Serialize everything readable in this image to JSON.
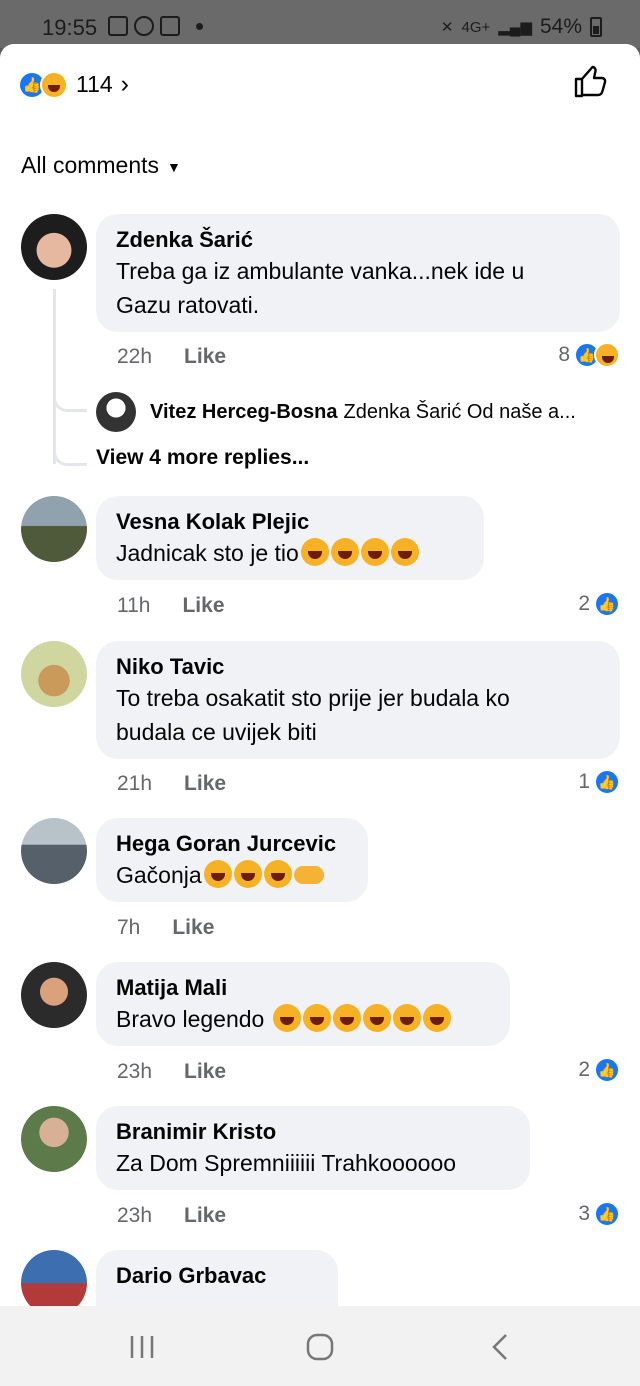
{
  "status_bar": {
    "time": "19:55",
    "network": "4G+",
    "battery": "54%"
  },
  "header": {
    "reaction_count": "114",
    "reactions": [
      "like",
      "haha"
    ]
  },
  "filter": {
    "label": "All comments"
  },
  "comments": [
    {
      "name": "Zdenka Šarić",
      "text": "Treba ga iz ambulante vanka...nek ide u\nGazu ratovati.",
      "time": "22h",
      "like_label": "Like",
      "reaction_count": "8",
      "reactions": [
        "like",
        "haha"
      ]
    },
    {
      "name": "Vesna Kolak Plejic",
      "text": "Jadnicak sto je tio",
      "time": "11h",
      "like_label": "Like",
      "reaction_count": "2",
      "reactions": [
        "like"
      ]
    },
    {
      "name": "Niko Tavic",
      "text": "To treba osakatit sto prije jer budala ko\nbudala ce uvijek biti",
      "time": "21h",
      "like_label": "Like",
      "reaction_count": "1",
      "reactions": [
        "like"
      ]
    },
    {
      "name": "Hega Goran Jurcevic",
      "text": "Gačonja",
      "time": "7h",
      "like_label": "Like"
    },
    {
      "name": "Matija Mali",
      "text": "Bravo legendo ",
      "time": "23h",
      "like_label": "Like",
      "reaction_count": "2",
      "reactions": [
        "like"
      ]
    },
    {
      "name": "Branimir Kristo",
      "text": "Za Dom Spremniiiiii Trahkoooooo",
      "time": "23h",
      "like_label": "Like",
      "reaction_count": "3",
      "reactions": [
        "like"
      ]
    },
    {
      "name": "Dario Grbavac"
    }
  ],
  "reply": {
    "name": "Vitez Herceg-Bosna",
    "text": "Zdenka Šarić Od naše a...",
    "more_replies": "View 4 more replies..."
  },
  "colors": {
    "facebook_blue": "#1877f2",
    "bubble_bg": "#f0f2f5",
    "secondary_text": "#65676b"
  }
}
